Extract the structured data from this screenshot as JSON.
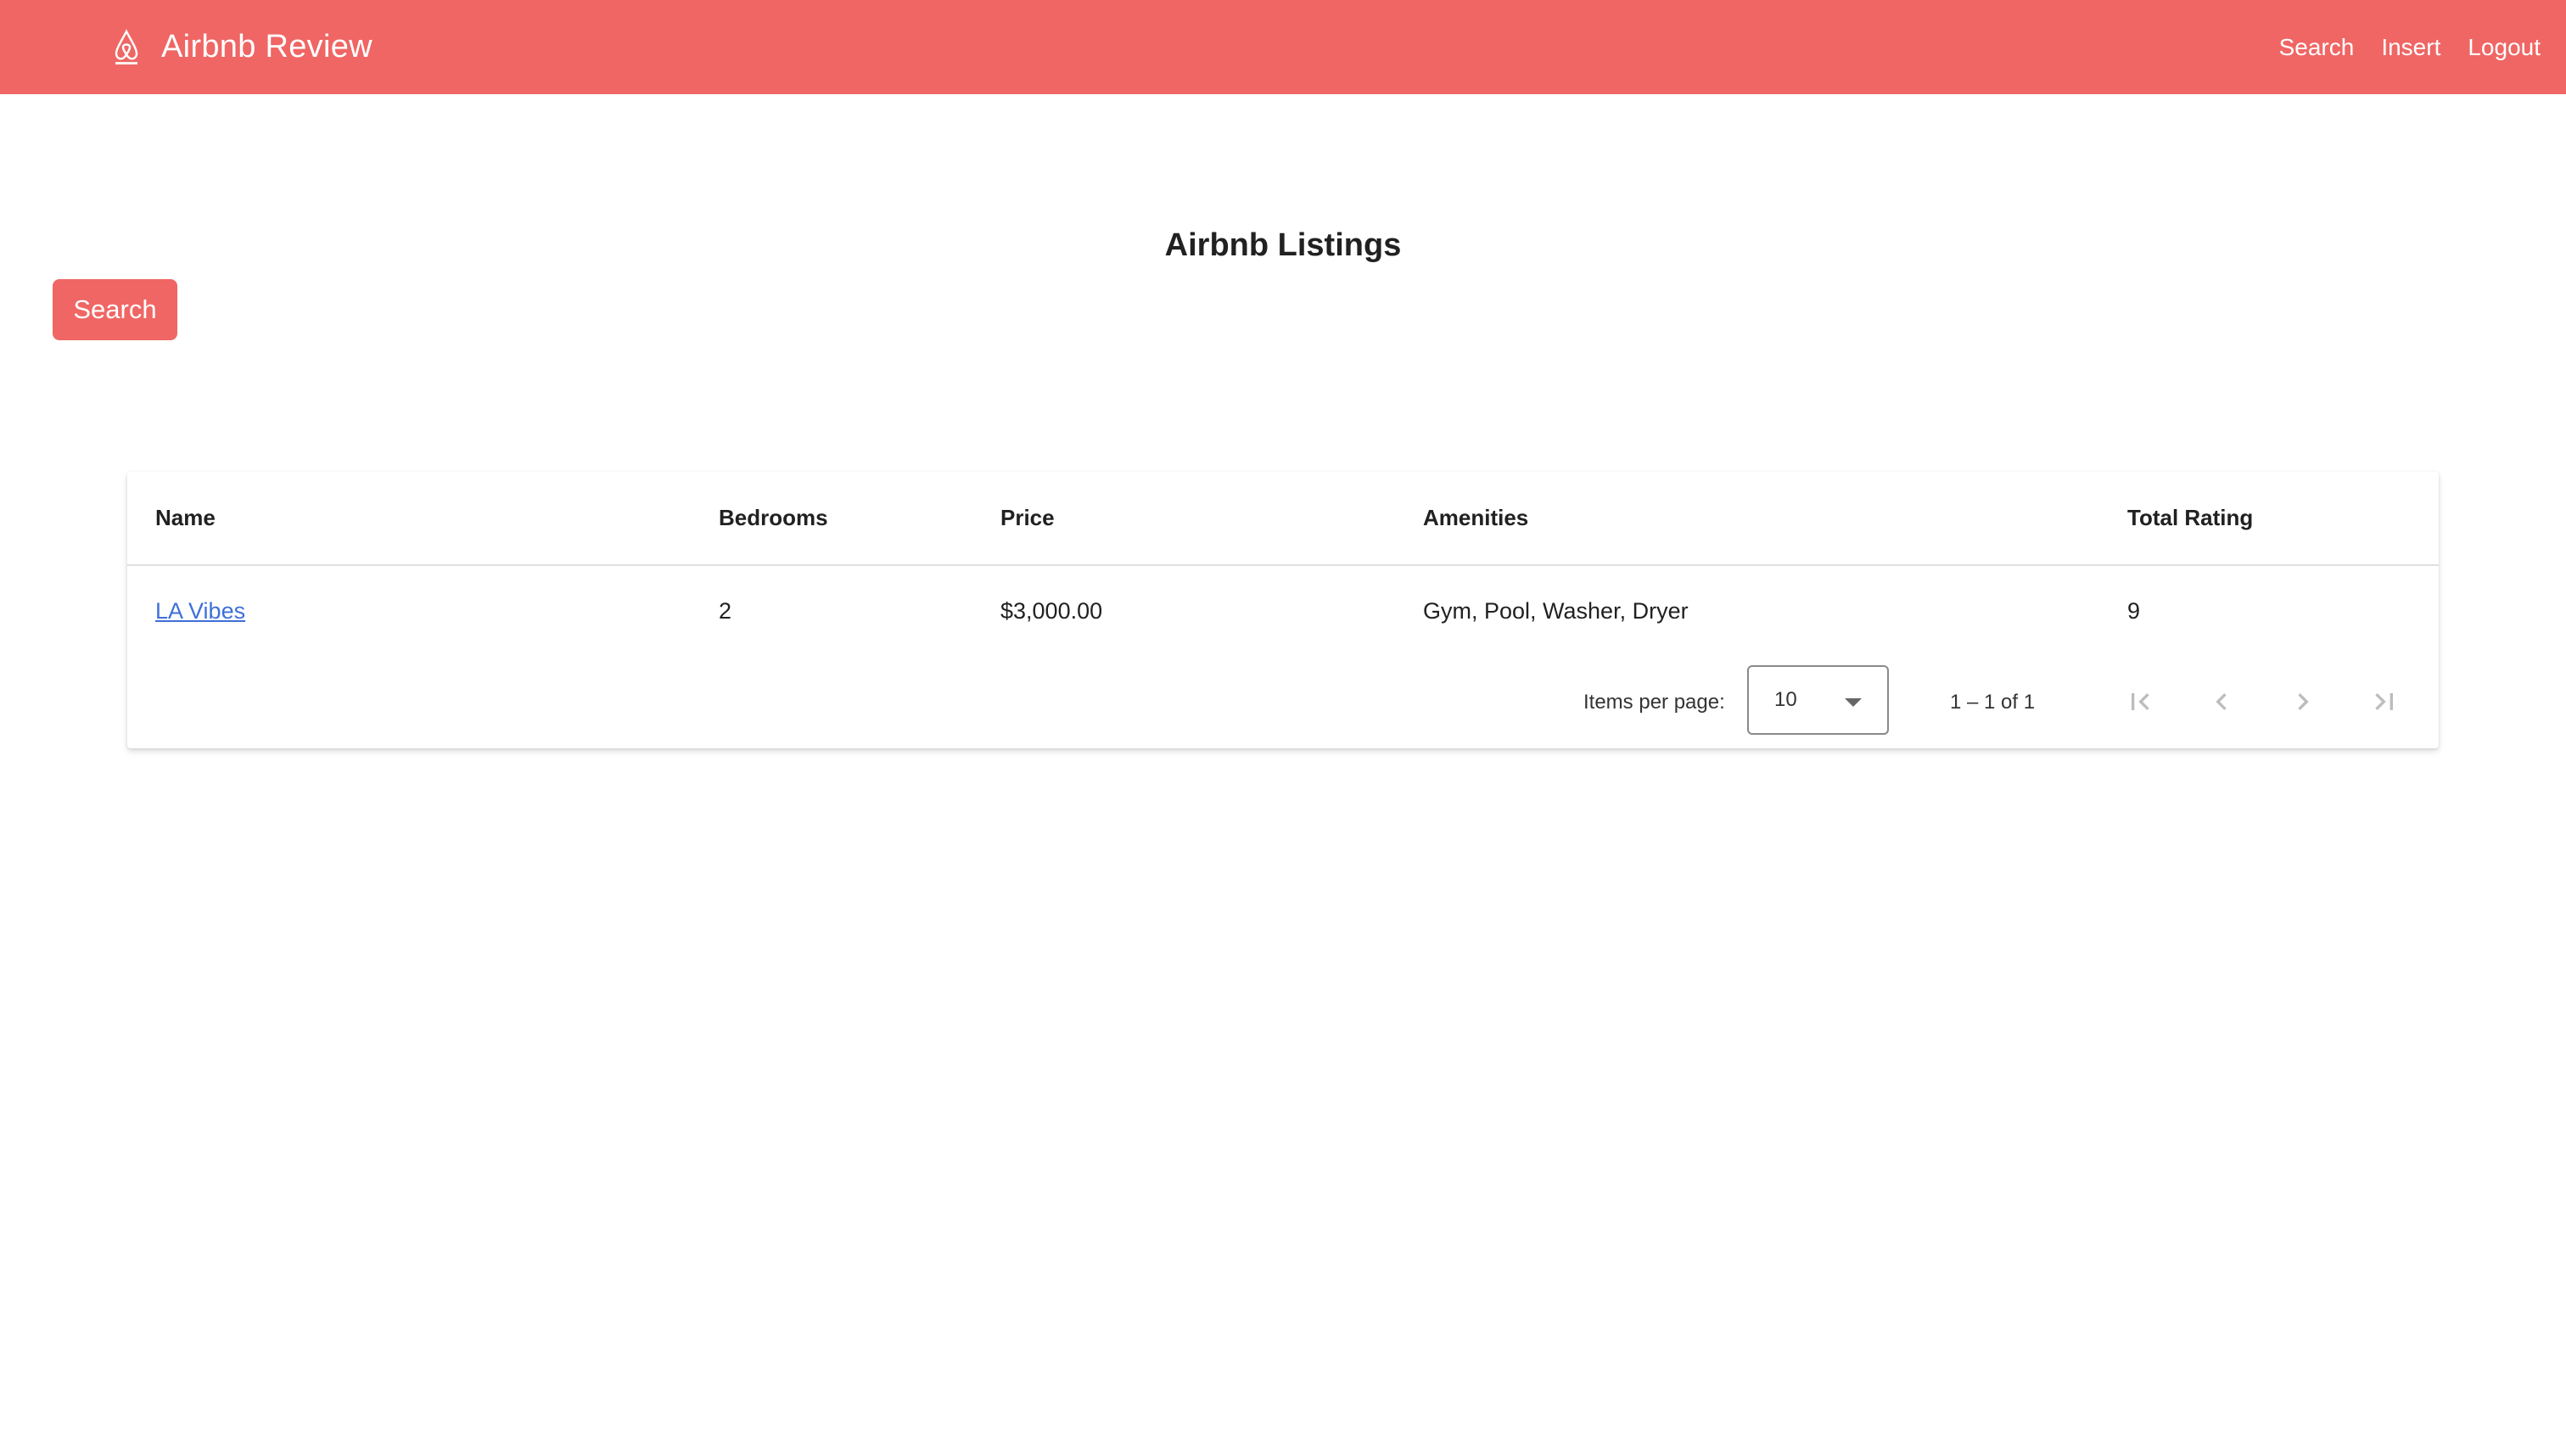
{
  "app": {
    "title": "Airbnb Review",
    "logo_icon": "airbnb-logo-icon",
    "brand_color": "#ef6664"
  },
  "nav": {
    "search": "Search",
    "insert": "Insert",
    "logout": "Logout"
  },
  "main": {
    "heading": "Airbnb Listings",
    "search_button": "Search"
  },
  "table": {
    "columns": [
      "Name",
      "Bedrooms",
      "Price",
      "Amenities",
      "Total Rating"
    ],
    "rows": [
      {
        "name": "LA Vibes",
        "bedrooms": "2",
        "price": "$3,000.00",
        "amenities": "Gym, Pool, Washer, Dryer",
        "total_rating": "9"
      }
    ]
  },
  "paginator": {
    "items_per_page_label": "Items per page:",
    "items_per_page_value": "10",
    "range_label": "1 – 1 of 1",
    "icons": [
      "first-page-icon",
      "previous-page-icon",
      "next-page-icon",
      "last-page-icon"
    ]
  }
}
